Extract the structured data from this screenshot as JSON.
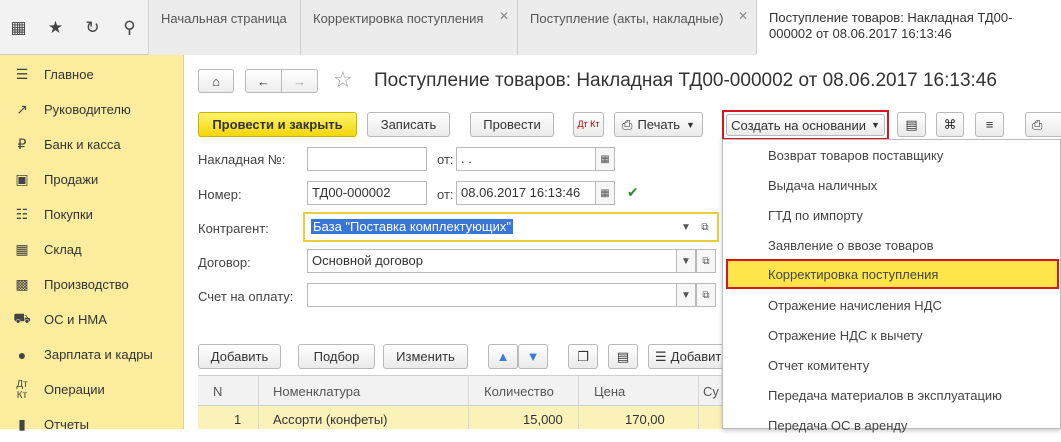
{
  "tabs": [
    "Начальная страница",
    "Корректировка поступления",
    "Поступление (акты, накладные)",
    "Поступление товаров: Накладная ТД00-000002 от 08.06.2017 16:13:46"
  ],
  "sidebar": [
    "Главное",
    "Руководителю",
    "Банк и касса",
    "Продажи",
    "Покупки",
    "Склад",
    "Производство",
    "ОС и НМА",
    "Зарплата и кадры",
    "Операции",
    "Отчеты"
  ],
  "title": "Поступление товаров: Накладная ТД00-000002 от 08.06.2017 16:13:46",
  "toolbar": {
    "post_close": "Провести и закрыть",
    "save": "Записать",
    "post": "Провести",
    "dtkt": "Дт Кт",
    "print": "Печать",
    "create_based": "Создать на основании"
  },
  "form": {
    "invoice_label": "Накладная №:",
    "from_label": "от:",
    "invoice_date": " .  .",
    "number_label": "Номер:",
    "number_value": "ТД00-000002",
    "date_value": "08.06.2017 16:13:46",
    "counterparty_label": "Контрагент:",
    "counterparty_value": "База \"Поставка комплектующих\"",
    "contract_label": "Договор:",
    "contract_value": "Основной договор",
    "payment_label": "Счет на оплату:"
  },
  "table_toolbar": {
    "add": "Добавить",
    "pick": "Подбор",
    "edit": "Изменить",
    "add2": "Добавить"
  },
  "table": {
    "headers": [
      "N",
      "Номенклатура",
      "Количество",
      "Цена",
      "Су"
    ],
    "rows": [
      [
        "1",
        "Ассорти (конфеты)",
        "15,000",
        "170,00"
      ]
    ]
  },
  "menu": [
    "Возврат товаров поставщику",
    "Выдача наличных",
    "ГТД по импорту",
    "Заявление о ввозе товаров",
    "Корректировка поступления",
    "Отражение начисления НДС",
    "Отражение НДС к вычету",
    "Отчет комитенту",
    "Передача материалов в эксплуатацию",
    "Передача ОС в аренду"
  ],
  "colors": {
    "accent_yellow": "#f2d70a",
    "sidebar": "#fbec9e",
    "highlight_border": "#d9151f"
  }
}
